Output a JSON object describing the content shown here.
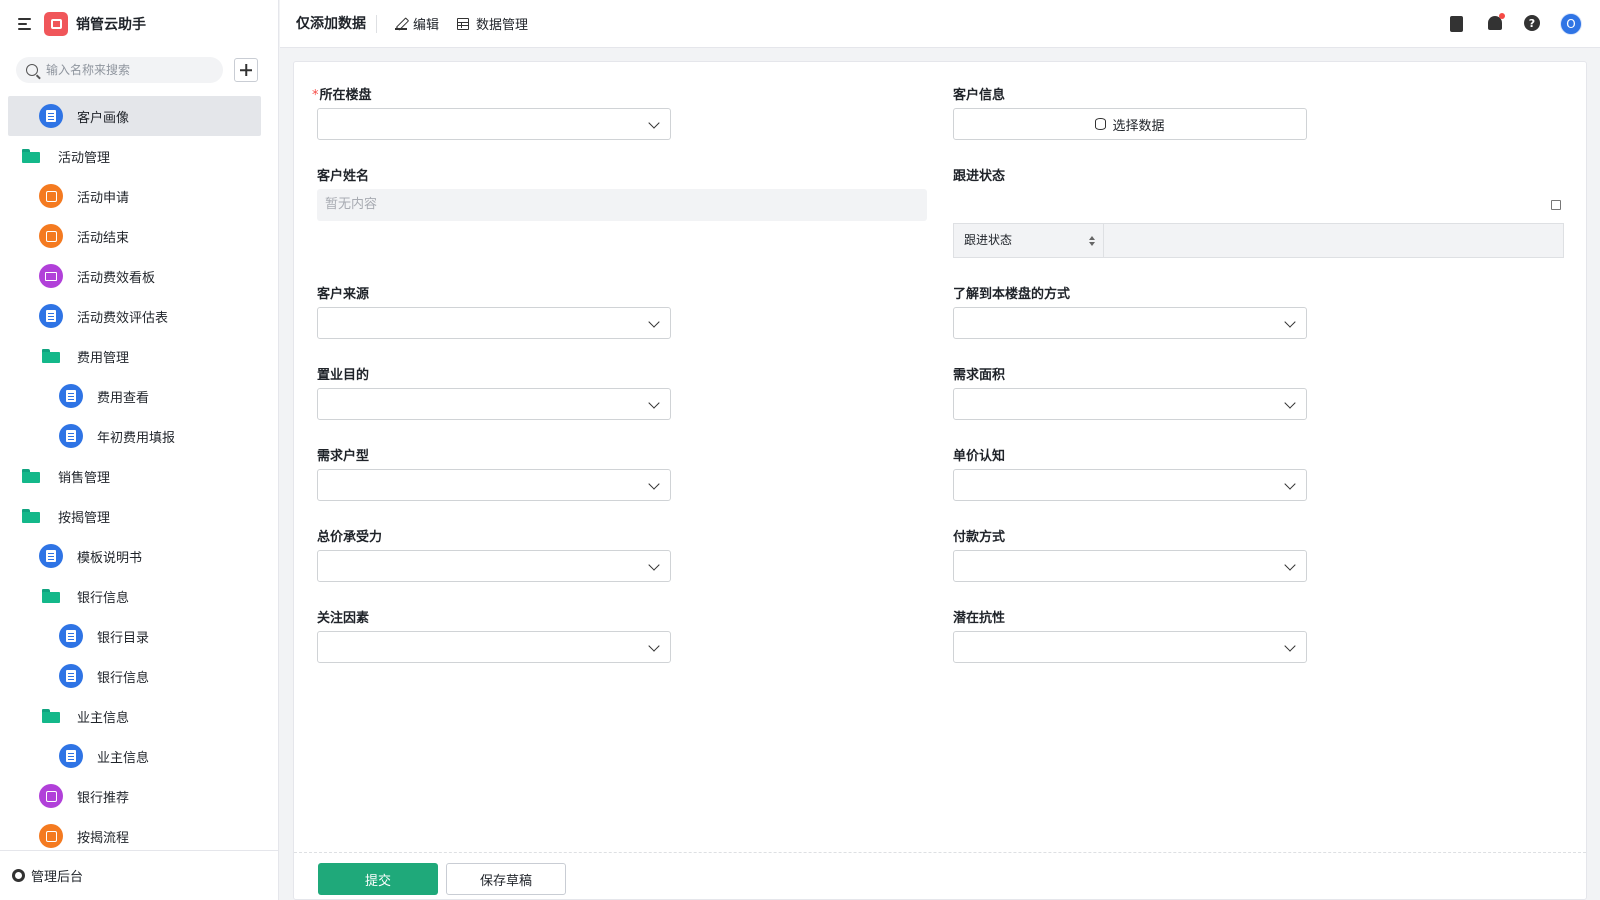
{
  "app": {
    "title": "销管云助手"
  },
  "search": {
    "placeholder": "输入名称来搜索"
  },
  "sidebar": {
    "items": [
      {
        "label": "客户画像"
      },
      {
        "label": "活动管理"
      },
      {
        "label": "活动申请"
      },
      {
        "label": "活动结束"
      },
      {
        "label": "活动费效看板"
      },
      {
        "label": "活动费效评估表"
      },
      {
        "label": "费用管理"
      },
      {
        "label": "费用查看"
      },
      {
        "label": "年初费用填报"
      },
      {
        "label": "销售管理"
      },
      {
        "label": "按揭管理"
      },
      {
        "label": "模板说明书"
      },
      {
        "label": "银行信息"
      },
      {
        "label": "银行目录"
      },
      {
        "label": "银行信息"
      },
      {
        "label": "业主信息"
      },
      {
        "label": "业主信息"
      },
      {
        "label": "银行推荐"
      },
      {
        "label": "按揭流程"
      }
    ],
    "footer_label": "管理后台"
  },
  "toolbar": {
    "title": "仅添加数据",
    "edit_label": "编辑",
    "data_manage_label": "数据管理",
    "avatar_letter": "O"
  },
  "form": {
    "required_mark": "*",
    "fields": {
      "building": "所在楼盘",
      "customer_info": "客户信息",
      "customer_name": "客户姓名",
      "follow_status": "跟进状态",
      "customer_source": "客户来源",
      "how_known": "了解到本楼盘的方式",
      "purpose": "置业目的",
      "area": "需求面积",
      "layout": "需求户型",
      "unit_price": "单价认知",
      "total_price": "总价承受力",
      "payment": "付款方式",
      "focus": "关注因素",
      "resistance": "潜在抗性"
    },
    "select_data_label": "选择数据",
    "empty_text": "暂无内容",
    "follow_table_header": "跟进状态",
    "submit_label": "提交",
    "draft_label": "保存草稿"
  },
  "colors": {
    "primary": "#1fa97a",
    "accent_blue": "#2f74e5",
    "required": "#f54a45"
  }
}
